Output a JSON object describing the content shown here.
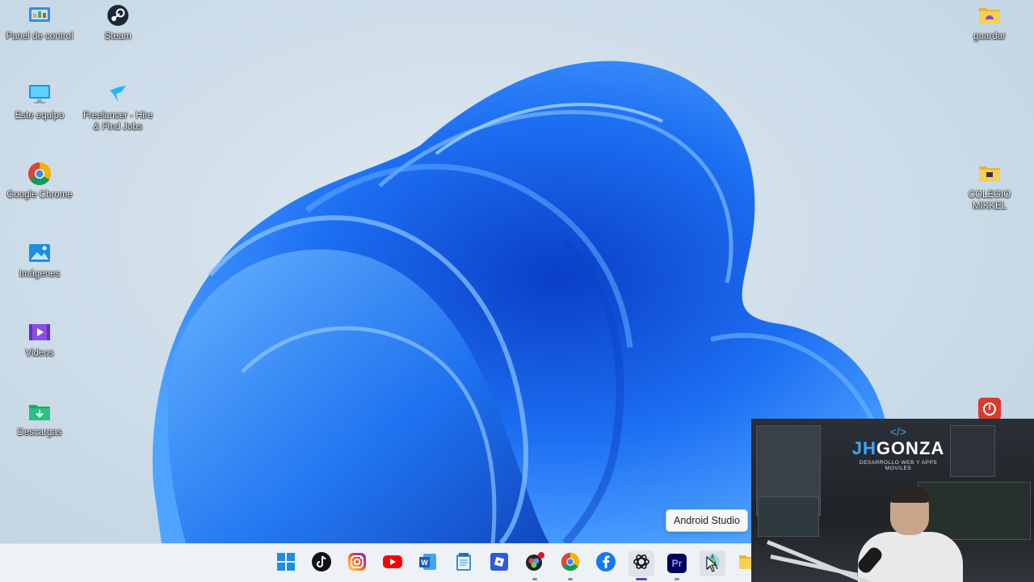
{
  "desktop": {
    "left_icons": [
      {
        "label": "Panel de control",
        "icon": "control-panel-icon"
      },
      {
        "label": "Steam",
        "icon": "steam-icon"
      },
      {
        "label": "Este equipo",
        "icon": "this-pc-icon"
      },
      {
        "label": "Freelancer - Hire & Find Jobs",
        "icon": "freelancer-icon"
      },
      {
        "label": "Google Chrome",
        "icon": "chrome-icon"
      },
      {
        "label": "Imágenes",
        "icon": "pictures-folder-icon"
      },
      {
        "label": "Videos",
        "icon": "videos-folder-icon"
      },
      {
        "label": "Descargas",
        "icon": "downloads-folder-icon"
      }
    ],
    "right_icons": [
      {
        "label": "guardar",
        "icon": "folder-icon"
      },
      {
        "label": "COLEGIO MIKKEL",
        "icon": "folder-icon"
      }
    ]
  },
  "tooltip": {
    "text": "Android Studio"
  },
  "taskbar": {
    "apps": [
      {
        "name": "start",
        "icon": "windows-start-icon",
        "running": false
      },
      {
        "name": "tiktok",
        "icon": "tiktok-icon",
        "running": false
      },
      {
        "name": "instagram",
        "icon": "instagram-icon",
        "running": false
      },
      {
        "name": "youtube",
        "icon": "youtube-icon",
        "running": false
      },
      {
        "name": "word",
        "icon": "word-icon",
        "running": false
      },
      {
        "name": "notepad",
        "icon": "notepad-icon",
        "running": false
      },
      {
        "name": "roblox",
        "icon": "roblox-icon",
        "running": false
      },
      {
        "name": "davinci",
        "icon": "davinci-icon",
        "running": true
      },
      {
        "name": "chrome",
        "icon": "chrome-icon",
        "running": true
      },
      {
        "name": "facebook",
        "icon": "facebook-icon",
        "running": false
      },
      {
        "name": "chatgpt",
        "icon": "chatgpt-icon",
        "running": true,
        "active": true
      },
      {
        "name": "premiere",
        "icon": "premiere-icon",
        "label": "Pr",
        "running": true
      },
      {
        "name": "android-studio",
        "icon": "android-studio-icon",
        "running": false,
        "hover": true
      },
      {
        "name": "file-explorer",
        "icon": "folder-icon",
        "running": false
      }
    ]
  },
  "webcam": {
    "brand_prefix": "JH",
    "brand_name": "GONZA",
    "brand_tagline": "DESARROLLO WEB Y APPS MOVILES"
  },
  "colors": {
    "accent": "#1a73e8",
    "bloom": "#1f6ff0",
    "taskbar_bg": "#eef2f6",
    "active_indicator": "#6a3fd2"
  }
}
